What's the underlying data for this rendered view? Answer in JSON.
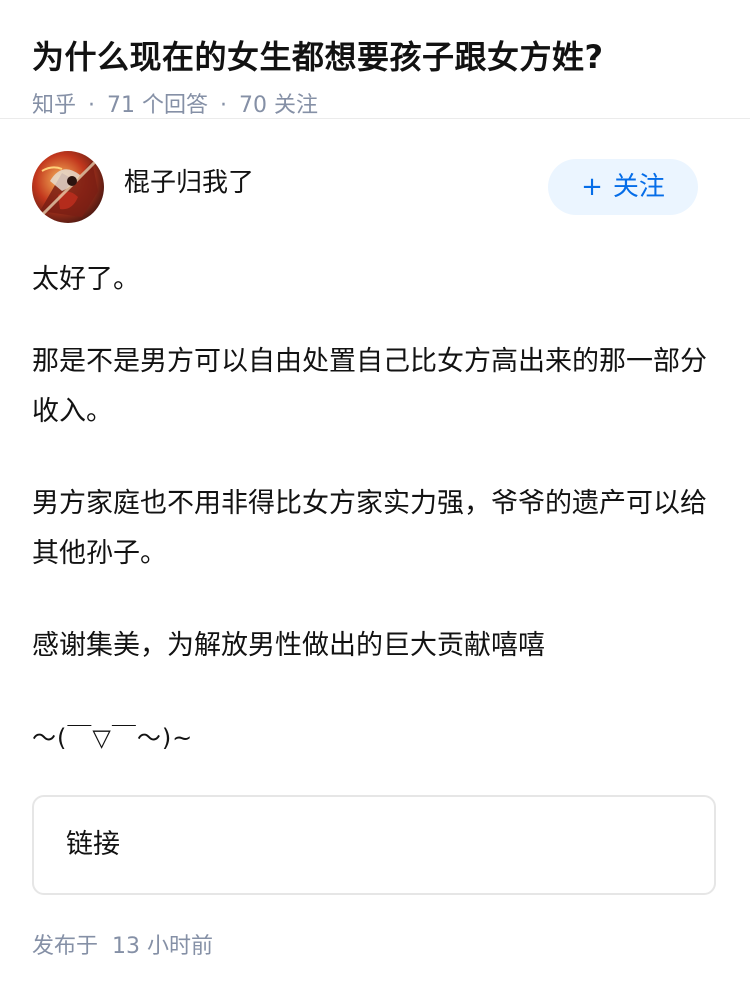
{
  "question": {
    "title": "为什么现在的女生都想要孩子跟女方姓?",
    "site": "知乎",
    "separator": "·",
    "answers_count": "71 个回答",
    "followers_count": "70 关注"
  },
  "answer": {
    "author": {
      "name": "棍子归我了",
      "avatar_icon": "avatar-image"
    },
    "follow_button": {
      "icon": "+",
      "label": "关注"
    },
    "paragraphs": [
      "太好了。",
      "那是不是男方可以自由处置自己比女方高出来的那一部分收入。",
      "男方家庭也不用非得比女方家实力强，爷爷的遗产可以给其他孙子。",
      "感谢集美，为解放男性做出的巨大贡献嘻嘻",
      "～(￣▽￣～)~"
    ],
    "link_card": {
      "label": "链接"
    },
    "published": {
      "label": "发布于",
      "time": "13 小时前"
    }
  },
  "colors": {
    "accent": "#056de8",
    "follow_bg": "#ebf5ff",
    "meta": "#8590a6",
    "text": "#121212"
  }
}
